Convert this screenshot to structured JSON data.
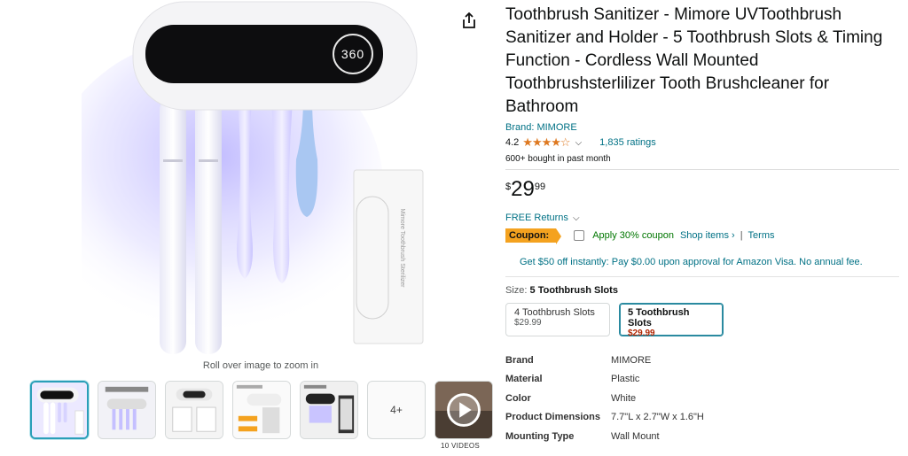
{
  "gallery": {
    "zoom_hint": "Roll over image to zoom in",
    "display_readout": "360",
    "box_text": "Mimore Toothbrush Sterilizer",
    "more_count": "4+",
    "videos_label": "10 VIDEOS"
  },
  "product": {
    "title": "Toothbrush Sanitizer - Mimore UVToothbrush Sanitizer and Holder - 5 Toothbrush Slots & Timing Function - Cordless Wall Mounted Toothbrushsterlilizer Tooth Brushcleaner for Bathroom",
    "brand": "Brand: MIMORE",
    "rating": "4.2",
    "rating_stars": 4.2,
    "ratings_count": "1,835 ratings",
    "bought": "600+ bought in past month",
    "price_symbol": "$",
    "price_whole": "29",
    "price_fraction": "99",
    "returns": "FREE Returns",
    "coupon_label": "Coupon:",
    "coupon_apply": "Apply 30% coupon",
    "shop_items": "Shop items ›",
    "separator": "|",
    "terms": "Terms",
    "visa_offer": "Get $50 off instantly: Pay $0.00 upon approval for Amazon Visa. No annual fee."
  },
  "size": {
    "label": "Size:",
    "selected": "5 Toothbrush Slots",
    "options": [
      {
        "name": "4 Toothbrush Slots",
        "price": "$29.99"
      },
      {
        "name": "5 Toothbrush Slots",
        "price": "$29.99"
      }
    ]
  },
  "specs": [
    {
      "key": "Brand",
      "value": "MIMORE"
    },
    {
      "key": "Material",
      "value": "Plastic"
    },
    {
      "key": "Color",
      "value": "White"
    },
    {
      "key": "Product Dimensions",
      "value": "7.7\"L x 2.7\"W x 1.6\"H"
    },
    {
      "key": "Mounting Type",
      "value": "Wall Mount"
    }
  ],
  "colors": {
    "star": "#de7921",
    "link": "#007185",
    "coupon": "#f4a21f",
    "price_red": "#b12704",
    "uv_glow": "#8f84ff"
  }
}
